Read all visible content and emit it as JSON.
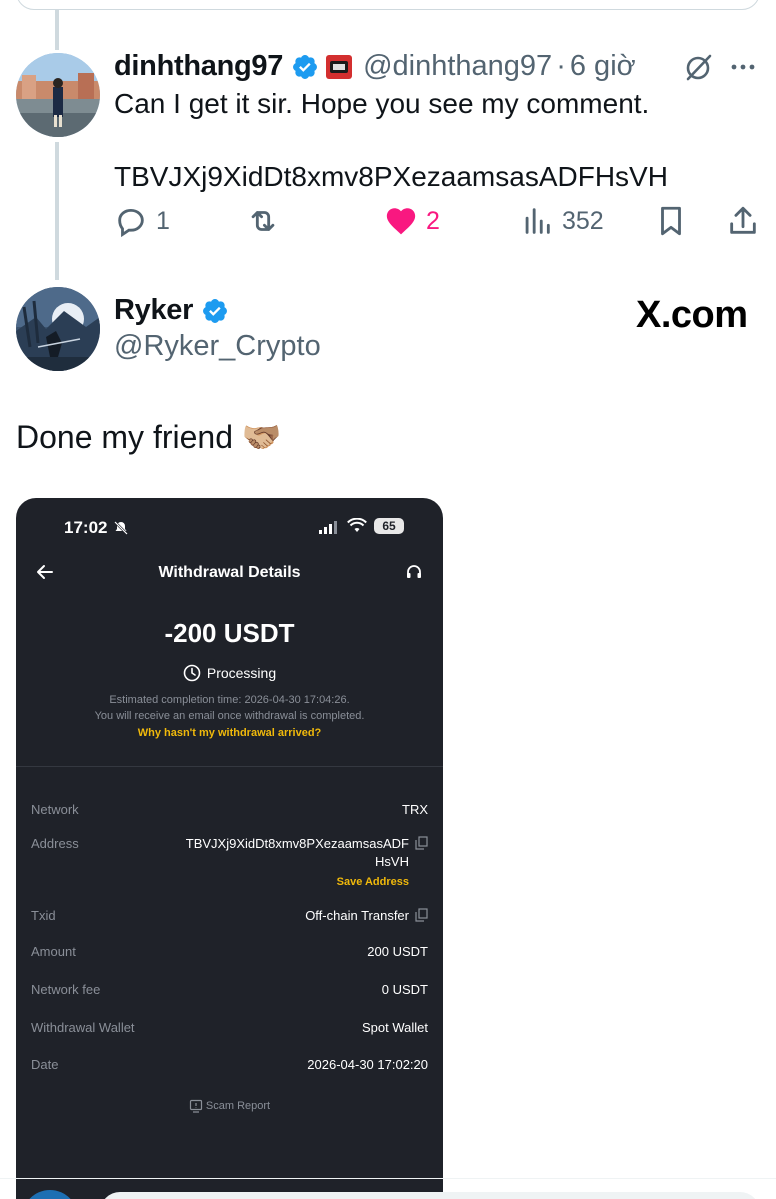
{
  "reply": {
    "name": "dinhthang97",
    "handle": "@dinhthang97",
    "sep": "·",
    "time": "6 giờ",
    "line1": "Can I get it sir. Hope you see my comment.",
    "line2": "TBVJXj9XidDt8xmv8PXezaamsasADFHsVH",
    "replies": "1",
    "likes": "2",
    "views": "352",
    "like_color": "#f91880"
  },
  "post": {
    "name": "Ryker",
    "handle": "@Ryker_Crypto",
    "watermark": "X.com",
    "text": "Done my friend 🫱🏼‍🫲🏽"
  },
  "phone": {
    "time": "17:02",
    "battery": "65",
    "title": "Withdrawal Details",
    "amount": "-200 USDT",
    "status": "Processing",
    "eta": "Estimated completion time: 2026-04-30 17:04:26.",
    "email_note": "You will receive an email once withdrawal is completed.",
    "why_link": "Why hasn't my withdrawal arrived?",
    "accent": "#f0b90b",
    "rows": {
      "network": {
        "label": "Network",
        "value": "TRX"
      },
      "address": {
        "label": "Address",
        "value_line1": "TBVJXj9XidDt8xmv8PXezaamsasADF",
        "value_line2": "HsVH",
        "save": "Save Address"
      },
      "txid": {
        "label": "Txid",
        "value": "Off-chain Transfer"
      },
      "amount": {
        "label": "Amount",
        "value": "200 USDT"
      },
      "fee": {
        "label": "Network fee",
        "value": "0 USDT"
      },
      "wallet": {
        "label": "Withdrawal Wallet",
        "value": "Spot Wallet"
      },
      "date": {
        "label": "Date",
        "value": "2026-04-30 17:02:20"
      }
    },
    "scam_report": "Scam Report"
  },
  "icons": {
    "verified": "verified-badge-icon",
    "reply": "comment-icon",
    "repost": "repost-icon",
    "like": "heart-icon",
    "views": "analytics-icon",
    "bookmark": "bookmark-icon",
    "share": "share-icon",
    "grok": "grok-icon",
    "more": "more-icon",
    "back": "back-arrow-icon",
    "support": "headset-icon",
    "clock": "clock-icon",
    "copy": "copy-icon"
  }
}
